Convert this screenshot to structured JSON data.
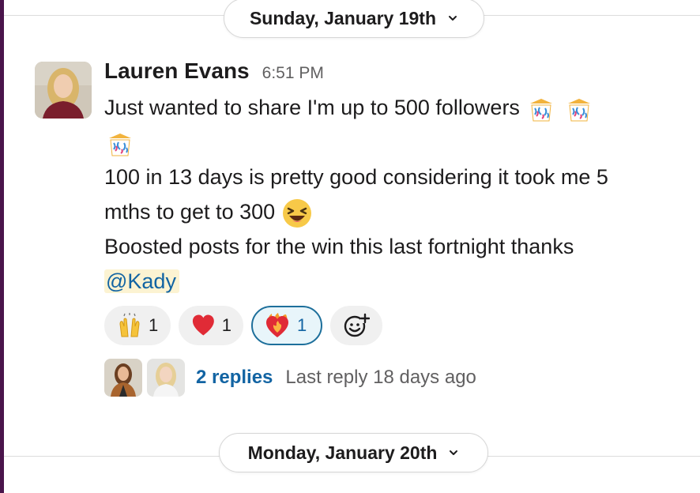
{
  "date_dividers": [
    {
      "label": "Sunday, January 19th"
    },
    {
      "label": "Monday, January 20th"
    }
  ],
  "message": {
    "author": "Lauren Evans",
    "time": "6:51 PM",
    "line1": "Just wanted to share I'm up to 500 followers",
    "line2": "100 in 13 days is pretty good considering it took me 5",
    "line3": "mths to get to 300",
    "line4": "Boosted posts for the win this last fortnight thanks",
    "mention": "@Kady"
  },
  "reactions": [
    {
      "emoji": "raising-hands",
      "count": "1"
    },
    {
      "emoji": "red-heart",
      "count": "1"
    },
    {
      "emoji": "heart-on-fire",
      "count": "1",
      "mine": true
    }
  ],
  "thread": {
    "replies": "2 replies",
    "last_reply": "Last reply 18 days ago"
  },
  "colors": {
    "link": "#1264a3",
    "mention_bg": "#fcf3d2",
    "mine_reaction_border": "#1d6f9b",
    "sidebar": "#4a154b"
  }
}
